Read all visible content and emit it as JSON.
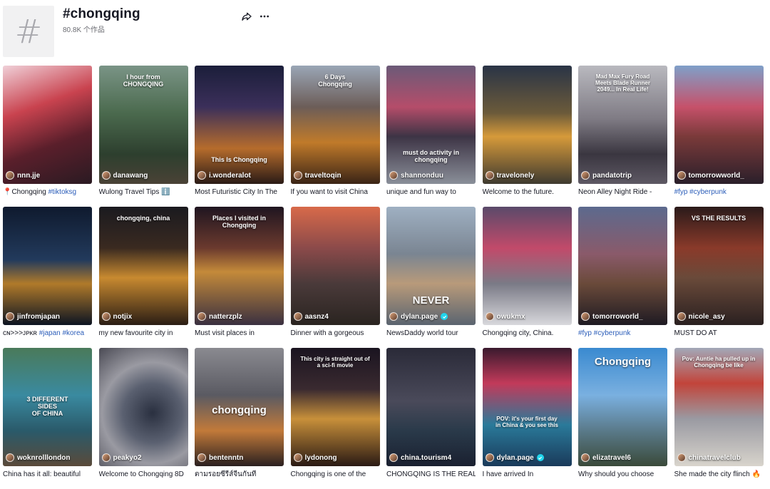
{
  "header": {
    "hash_symbol": "#",
    "title": "#chongqing",
    "count_label": "80.8K 个作品",
    "share_icon": "share-icon",
    "more_icon": "more-icon"
  },
  "videos": [
    {
      "author": "nnn.jje",
      "caption": "📍Chongqing ",
      "tags": "#tiktoksg",
      "overlay": "",
      "bg": "linear-gradient(160deg,#f0d0d8 0%,#c9434f 35%,#5a1f2b 65%,#2a1a22 100%)"
    },
    {
      "author": "danawang",
      "caption": "Wulong Travel Tips ℹ️",
      "tags": "",
      "overlay": "I hour from\nCHONGQING",
      "bg": "linear-gradient(180deg,#7a9486 0%,#4b6a4e 40%,#2d3f2e 75%,#4a4236 100%)"
    },
    {
      "author": "i.wonderalot",
      "caption": "Most Futuristic City In The",
      "tags": "",
      "overlay": "This Is Chongqing",
      "bg": "linear-gradient(180deg,#1b1e3a 0%,#3b2f5a 35%,#b66c2c 70%,#2a1b16 100%)"
    },
    {
      "author": "traveltoqin",
      "caption": "If you want to visit China",
      "tags": "",
      "overlay": "6 Days\nChongqing",
      "bg": "linear-gradient(180deg,#9aa6b6 0%,#6c5d58 35%,#c07a2a 65%,#3a2416 100%)"
    },
    {
      "author": "shannonduu",
      "caption": "unique and fun way to",
      "tags": "",
      "overlay": "must do activity in chongqing",
      "bg": "linear-gradient(180deg,#6b5a78 0%,#b54d6a 35%,#3d3445 60%,#8a8f99 100%)"
    },
    {
      "author": "travelonely",
      "caption": "Welcome to the future.",
      "tags": "",
      "overlay": "",
      "bg": "linear-gradient(180deg,#2a3446 0%,#6b5a3a 40%,#d69a3a 60%,#3e3a30 100%)"
    },
    {
      "author": "pandatotrip",
      "caption": "Neon Alley Night Ride -",
      "tags": "",
      "overlay": "Mad Max Fury Road\nMeets Blade Runner\n2049... In Real Life!",
      "bg": "linear-gradient(180deg,#b9b9bf 0%,#7f7b84 45%,#3a3640 75%,#5e5964 100%)"
    },
    {
      "author": "tomorrowworld_",
      "caption": "",
      "tags": "#fyp #cyberpunk",
      "overlay": "",
      "bg": "linear-gradient(180deg,#7fa0c9 0%,#c6516a 35%,#7a3a3a 60%,#2a1f2a 100%)"
    },
    {
      "author": "jinfromjapan",
      "caption": "ᴄɴ>>>ᴊᴘᴋʀ ",
      "tags": "#japan #korea",
      "overlay": "",
      "bg": "linear-gradient(180deg,#0f1a2e 0%,#223a5c 45%,#b07a2a 65%,#0c1422 100%)"
    },
    {
      "author": "notjix",
      "caption": "my new favourite city in",
      "tags": "",
      "overlay": "chongqing, china",
      "bg": "linear-gradient(180deg,#1a1a1f 0%,#3a2a20 35%,#c88a30 60%,#2a1d14 100%)"
    },
    {
      "author": "natterzplz",
      "caption": "Must visit places in",
      "tags": "",
      "overlay": "Places I visited in\nChongqing",
      "bg": "linear-gradient(180deg,#1f1520 0%,#6b3a2e 35%,#c48a3a 55%,#3a3040 100%)"
    },
    {
      "author": "aasnz4",
      "caption": "Dinner with a gorgeous",
      "tags": "",
      "overlay": "",
      "bg": "linear-gradient(180deg,#d86a4a 0%,#8b4a4a 35%,#4a3a3a 65%,#2a2420 100%)"
    },
    {
      "author": "dylan.page",
      "caption": "NewsDaddy world tour",
      "tags": "",
      "overlay": "NEVER",
      "verified": true,
      "bg": "linear-gradient(180deg,#9fb0c2 0%,#7a8592 40%,#b89a7a 65%,#5a6470 100%)"
    },
    {
      "author": "owukmx",
      "caption": "Chongqing city, China.",
      "tags": "",
      "overlay": "",
      "bg": "linear-gradient(180deg,#5a4a6a 0%,#c24a6a 35%,#7a7a86 65%,#d8d8dc 100%)"
    },
    {
      "author": "tomorroworld_",
      "caption": "",
      "tags": "#fyp #cyberpunk",
      "overlay": "",
      "bg": "linear-gradient(180deg,#5c6a8e 0%,#8a5a6a 40%,#6a4a3a 65%,#1e1a22 100%)"
    },
    {
      "author": "nicole_asy",
      "caption": "MUST DO AT",
      "tags": "",
      "overlay": "VS THE RESULTS",
      "bg": "linear-gradient(180deg,#2a1a1a 0%,#8a3a2a 35%,#6a4a3a 60%,#2a2020 100%)"
    },
    {
      "author": "woknrolllondon",
      "caption": "China has it all: beautiful",
      "tags": "",
      "overlay": "3 DIFFERENT\nSIDES\nOF CHINA",
      "bg": "linear-gradient(180deg,#4a7a5a 0%,#3a8aa0 40%,#2a5a6a 70%,#5a4a3a 100%)"
    },
    {
      "author": "peakyo2",
      "caption": "Welcome to Chongqing 8D",
      "tags": "",
      "overlay": "",
      "bg": "radial-gradient(circle at 60% 55%,#2a3040 0%,#5a6070 35%,#9a9aa2 60%,#4a4a54 100%)"
    },
    {
      "author": "bentenntn",
      "caption": "ตามรอยซีรีส์จีนกันที่",
      "tags": "",
      "overlay": "chongqing",
      "bg": "linear-gradient(180deg,#8a8a90 0%,#5a5a62 40%,#c27a3a 70%,#2a2020 100%)"
    },
    {
      "author": "lydonong",
      "caption": "Chongqing is one of the",
      "tags": "",
      "overlay": "This city is straight out of\na sci-fi movie",
      "bg": "linear-gradient(180deg,#1a1420 0%,#3a2a30 35%,#c8903a 60%,#2a1a14 100%)"
    },
    {
      "author": "china.tourism4",
      "caption": "CHONGQING IS THE REAL-",
      "tags": "",
      "overlay": "",
      "bg": "linear-gradient(180deg,#2a2a38 0%,#4a4a5a 45%,#2a3a4a 70%,#1a2030 100%)"
    },
    {
      "author": "dylan.page",
      "caption": "I have arrived In",
      "tags": "",
      "overlay": "POV: it's your first day\nin China & you see this",
      "verified": true,
      "bg": "linear-gradient(180deg,#3a1a2e 0%,#c23a5a 30%,#2a7a9a 65%,#1a3a5a 100%)"
    },
    {
      "author": "elizatravel6",
      "caption": "Why should you choose",
      "tags": "",
      "overlay": "Chongqing",
      "bg": "linear-gradient(180deg,#3a8ad0 0%,#7ab0e0 40%,#5a7a8a 70%,#3a4a3a 100%)"
    },
    {
      "author": "chinatravelclub",
      "caption": "She made the city flinch 🔥",
      "tags": "",
      "overlay": "Pov: Auntie ha pulled up in\nChongqing be like",
      "bg": "linear-gradient(180deg,#a2a8b8 0%,#c2443a 30%,#9a9aa2 60%,#d8d4cc 100%)"
    }
  ]
}
